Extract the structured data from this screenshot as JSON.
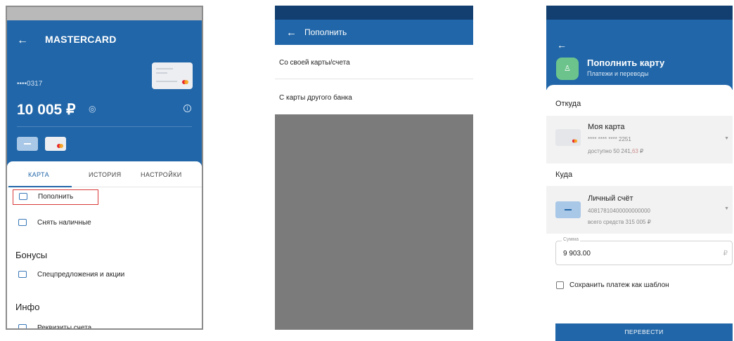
{
  "screen1": {
    "title": "MASTERCARD",
    "card_masked": "••••0317",
    "balance": "10 005 ₽",
    "tabs": [
      "КАРТА",
      "ИСТОРИЯ",
      "НАСТРОЙКИ"
    ],
    "actions": [
      "Пополнить",
      "Снять наличные"
    ],
    "bonuses_header": "Бонусы",
    "bonuses_items": [
      "Спецпредложения и акции"
    ],
    "info_header": "Инфо",
    "info_items": [
      "Реквизиты счета"
    ]
  },
  "screen2": {
    "title": "Пополнить",
    "options": [
      "Со своей карты/счета",
      "С карты другого банка"
    ]
  },
  "screen3": {
    "title": "Пополнить карту",
    "subtitle": "Платежи и переводы",
    "from_label": "Откуда",
    "from_name": "Моя карта",
    "from_number": "**** **** **** 2251",
    "from_available_main": "доступно 50 241,",
    "from_available_kop": "63",
    "from_available_cur": " ₽",
    "to_label": "Куда",
    "to_name": "Личный счёт",
    "to_number": "40817810400000000000",
    "to_total": "всего средств 315 005 ₽",
    "amount_label": "Сумма",
    "amount_value": "9 903.00",
    "currency_symbol": "₽",
    "save_template_label": "Сохранить платеж как шаблон",
    "submit_label": "ПЕРЕВЕСТИ"
  },
  "colors": {
    "primary_blue": "#2166a8",
    "dark_status": "#123f6f",
    "highlight_red": "#d93a3a",
    "avatar_green": "#6cc48c"
  },
  "icons": [
    "back-arrow-icon",
    "eye-icon",
    "info-icon",
    "mastercard-icon",
    "top-up-icon",
    "cash-withdraw-icon",
    "offers-icon",
    "account-details-icon",
    "user-icon",
    "chevron-down-icon",
    "checkbox-icon"
  ]
}
